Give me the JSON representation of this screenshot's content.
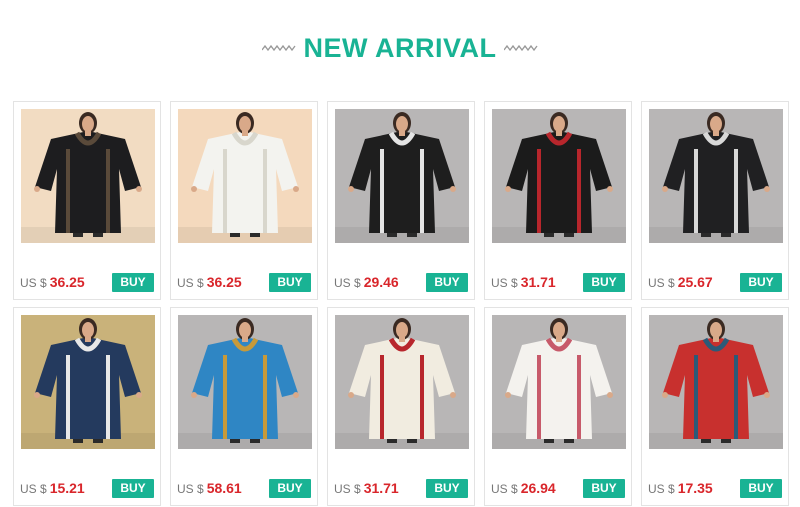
{
  "header": {
    "title": "NEW ARRIVAL",
    "accent_color": "#19b394"
  },
  "products": [
    {
      "currency": "US $",
      "price": "36.25",
      "buy_label": "BUY",
      "image": "black-lace-kaftan",
      "bg": "#f2dcc2",
      "dress": "#1d1d1f",
      "trim": "#5a4a3a"
    },
    {
      "currency": "US $",
      "price": "36.25",
      "buy_label": "BUY",
      "image": "white-kaftan-straw-hat",
      "bg": "#f4d9bd",
      "dress": "#f3f3ef",
      "trim": "#d8d6cc"
    },
    {
      "currency": "US $",
      "price": "29.46",
      "buy_label": "BUY",
      "image": "black-embroidered-kaftan-straw-hat",
      "bg": "#b8b6b6",
      "dress": "#1e1e1e",
      "trim": "#e4e4e4"
    },
    {
      "currency": "US $",
      "price": "31.71",
      "buy_label": "BUY",
      "image": "black-red-embroidered-kaftan",
      "bg": "#b8b6b6",
      "dress": "#1b1b1b",
      "trim": "#b8262c"
    },
    {
      "currency": "US $",
      "price": "25.67",
      "buy_label": "BUY",
      "image": "black-floral-kaftan",
      "bg": "#b8b6b6",
      "dress": "#202022",
      "trim": "#d8d8d8"
    },
    {
      "currency": "US $",
      "price": "15.21",
      "buy_label": "BUY",
      "image": "blue-print-kaftan-field",
      "bg": "#c9b27a",
      "dress": "#243a5e",
      "trim": "#e8e8e8"
    },
    {
      "currency": "US $",
      "price": "58.61",
      "buy_label": "BUY",
      "image": "blue-embroidered-kaftan",
      "bg": "#b8b6b6",
      "dress": "#2f86c4",
      "trim": "#c79a3a"
    },
    {
      "currency": "US $",
      "price": "31.71",
      "buy_label": "BUY",
      "image": "cream-red-embroidered-kaftan",
      "bg": "#b8b6b6",
      "dress": "#f1ece0",
      "trim": "#b8262c"
    },
    {
      "currency": "US $",
      "price": "26.94",
      "buy_label": "BUY",
      "image": "white-floral-kaftan",
      "bg": "#b8b6b6",
      "dress": "#f4f2ee",
      "trim": "#c75a6a"
    },
    {
      "currency": "US $",
      "price": "17.35",
      "buy_label": "BUY",
      "image": "red-print-kaftan",
      "bg": "#b8b6b6",
      "dress": "#c8302e",
      "trim": "#2c5a78"
    }
  ]
}
